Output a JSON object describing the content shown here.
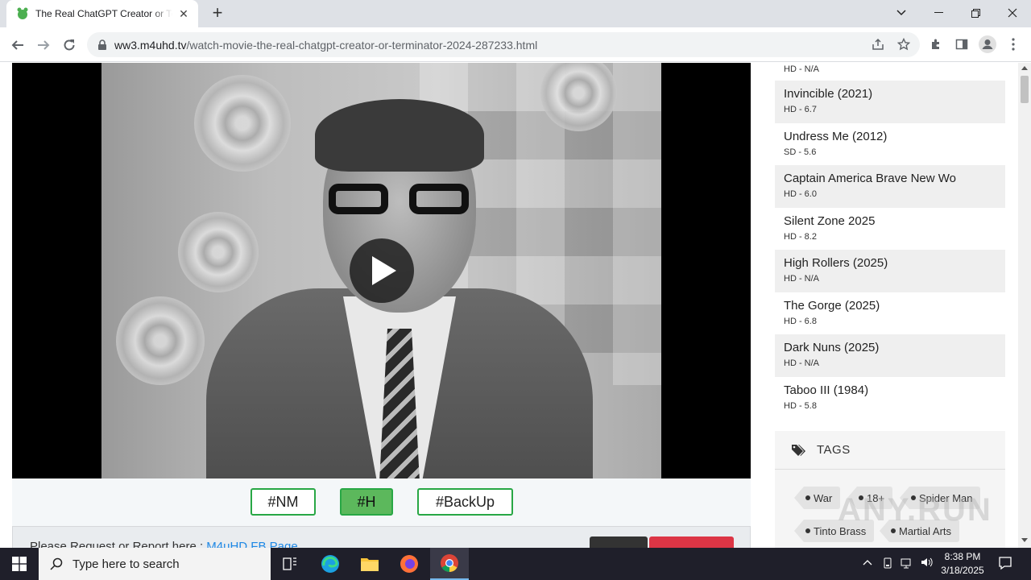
{
  "browser": {
    "tab_title": "The Real ChatGPT Creator or Terminator",
    "tab_close": "✕",
    "new_tab": "+",
    "url_domain": "ww3.m4uhd.tv",
    "url_path": "/watch-movie-the-real-chatgpt-creator-or-terminator-2024-287233.html"
  },
  "player": {
    "play_icon": "play-icon"
  },
  "servers": [
    {
      "label": "#NM",
      "active": false
    },
    {
      "label": "#H",
      "active": true
    },
    {
      "label": "#BackUp",
      "active": false
    }
  ],
  "report": {
    "text": "Please Request or Report here : ",
    "link": "M4uHD FB Page"
  },
  "sidebar": {
    "first_meta": "HD - N/A",
    "movies": [
      {
        "title": "Invincible (2021)",
        "meta": "HD - 6.7"
      },
      {
        "title": "Undress Me (2012)",
        "meta": "SD - 5.6"
      },
      {
        "title": "Captain America Brave New Wo",
        "meta": "HD - 6.0"
      },
      {
        "title": "Silent Zone 2025",
        "meta": "HD - 8.2"
      },
      {
        "title": "High Rollers (2025)",
        "meta": "HD - N/A"
      },
      {
        "title": "The Gorge (2025)",
        "meta": "HD - 6.8"
      },
      {
        "title": "Dark Nuns (2025)",
        "meta": "HD - N/A"
      },
      {
        "title": "Taboo III (1984)",
        "meta": "HD - 5.8"
      }
    ],
    "tags_title": "TAGS",
    "tags": [
      "War",
      "18+",
      "Spider Man",
      "Tinto Brass",
      "Martial Arts"
    ]
  },
  "watermark": "ANY.RUN",
  "taskbar": {
    "search_placeholder": "Type here to search",
    "time": "8:38 PM",
    "date": "3/18/2025"
  },
  "colors": {
    "server_border": "#28a745",
    "server_active": "#5cb85c",
    "link": "#1e88e5"
  }
}
